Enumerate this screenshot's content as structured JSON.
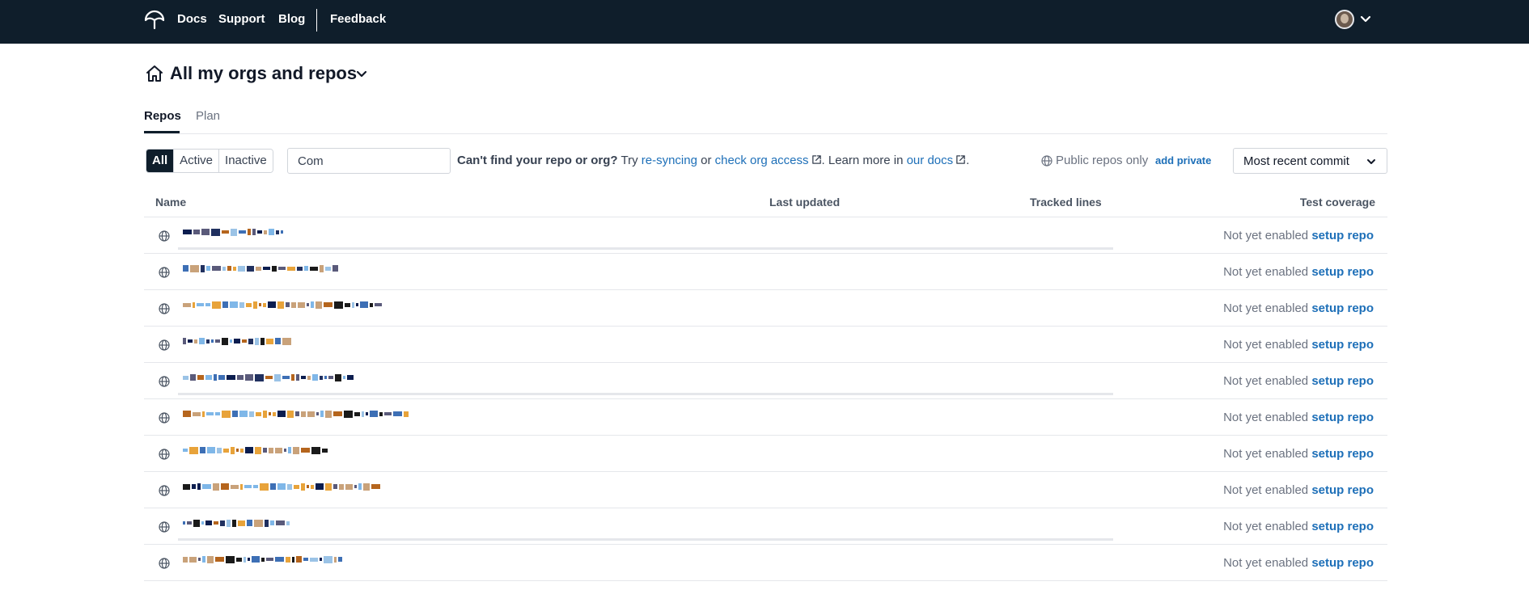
{
  "colors": {
    "navbar": "#0f1e2b",
    "link": "#1d6fb8",
    "border": "#d1d5db",
    "muted": "#6b7280"
  },
  "navbar": {
    "logo_icon": "umbrella-logo-icon",
    "links": [
      "Docs",
      "Support",
      "Blog",
      "Feedback"
    ],
    "user_menu_icon": "chevron-down-icon"
  },
  "org": {
    "icon": "home-icon",
    "title": "All my orgs and repos"
  },
  "tabs": [
    "Repos",
    "Plan"
  ],
  "filters": {
    "segments": [
      "All",
      "Active",
      "Inactive"
    ],
    "active_segment": "All",
    "search_value": "Com",
    "help": {
      "question": "Can't find your repo or org?",
      "try": "Try",
      "resync_link": "re-syncing",
      "or": "or",
      "access_link": "check org access",
      "learn": ". Learn more in",
      "docs_link": "our docs",
      "end": "."
    },
    "visibility_label": "Public repos only",
    "add_private_link": "add private",
    "sort_value": "Most recent commit"
  },
  "table": {
    "columns": [
      "Name",
      "Last updated",
      "Tracked lines",
      "Test coverage"
    ],
    "rows": [
      {
        "status": "Not yet enabled",
        "action": "setup repo"
      },
      {
        "status": "Not yet enabled",
        "action": "setup repo"
      },
      {
        "status": "Not yet enabled",
        "action": "setup repo"
      },
      {
        "status": "Not yet enabled",
        "action": "setup repo"
      },
      {
        "status": "Not yet enabled",
        "action": "setup repo"
      },
      {
        "status": "Not yet enabled",
        "action": "setup repo"
      },
      {
        "status": "Not yet enabled",
        "action": "setup repo"
      },
      {
        "status": "Not yet enabled",
        "action": "setup repo"
      },
      {
        "status": "Not yet enabled",
        "action": "setup repo"
      },
      {
        "status": "Not yet enabled",
        "action": "setup repo"
      }
    ]
  }
}
